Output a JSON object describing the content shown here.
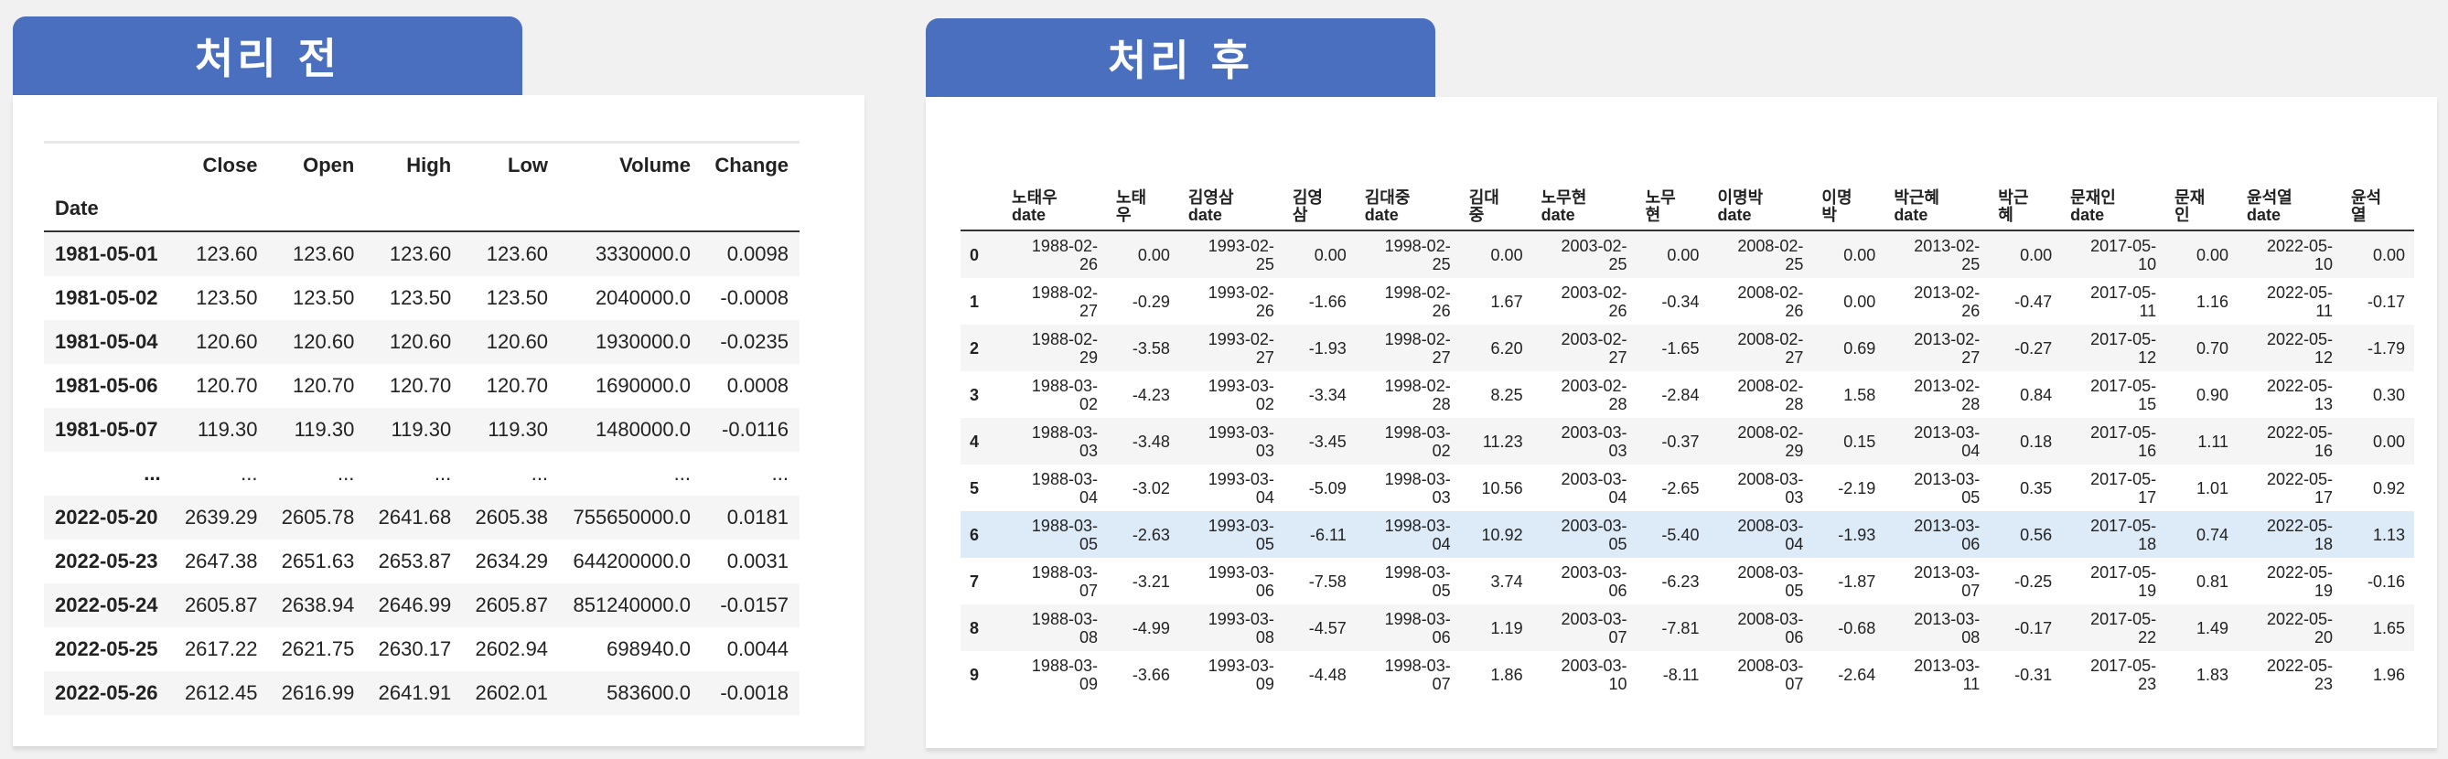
{
  "left_panel": {
    "title": "처리 전",
    "columns": [
      "Close",
      "Open",
      "High",
      "Low",
      "Volume",
      "Change"
    ],
    "index_name": "Date",
    "rows": [
      {
        "date": "1981-05-01",
        "values": [
          "123.60",
          "123.60",
          "123.60",
          "123.60",
          "3330000.0",
          "0.0098"
        ]
      },
      {
        "date": "1981-05-02",
        "values": [
          "123.50",
          "123.50",
          "123.50",
          "123.50",
          "2040000.0",
          "-0.0008"
        ]
      },
      {
        "date": "1981-05-04",
        "values": [
          "120.60",
          "120.60",
          "120.60",
          "120.60",
          "1930000.0",
          "-0.0235"
        ]
      },
      {
        "date": "1981-05-06",
        "values": [
          "120.70",
          "120.70",
          "120.70",
          "120.70",
          "1690000.0",
          "0.0008"
        ]
      },
      {
        "date": "1981-05-07",
        "values": [
          "119.30",
          "119.30",
          "119.30",
          "119.30",
          "1480000.0",
          "-0.0116"
        ]
      },
      {
        "date": "...",
        "values": [
          "...",
          "...",
          "...",
          "...",
          "...",
          "..."
        ]
      },
      {
        "date": "2022-05-20",
        "values": [
          "2639.29",
          "2605.78",
          "2641.68",
          "2605.38",
          "755650000.0",
          "0.0181"
        ]
      },
      {
        "date": "2022-05-23",
        "values": [
          "2647.38",
          "2651.63",
          "2653.87",
          "2634.29",
          "644200000.0",
          "0.0031"
        ]
      },
      {
        "date": "2022-05-24",
        "values": [
          "2605.87",
          "2638.94",
          "2646.99",
          "2605.87",
          "851240000.0",
          "-0.0157"
        ]
      },
      {
        "date": "2022-05-25",
        "values": [
          "2617.22",
          "2621.75",
          "2630.17",
          "2602.94",
          "698940.0",
          "0.0044"
        ]
      },
      {
        "date": "2022-05-26",
        "values": [
          "2612.45",
          "2616.99",
          "2641.91",
          "2602.01",
          "583600.0",
          "-0.0018"
        ]
      }
    ]
  },
  "right_panel": {
    "title": "처리 후",
    "columns": [
      {
        "l1": "노태우",
        "l2": "date"
      },
      {
        "l1": "노태",
        "l2": "우"
      },
      {
        "l1": "김영삼",
        "l2": "date"
      },
      {
        "l1": "김영",
        "l2": "삼"
      },
      {
        "l1": "김대중",
        "l2": "date"
      },
      {
        "l1": "김대",
        "l2": "중"
      },
      {
        "l1": "노무현",
        "l2": "date"
      },
      {
        "l1": "노무",
        "l2": "현"
      },
      {
        "l1": "이명박",
        "l2": "date"
      },
      {
        "l1": "이명",
        "l2": "박"
      },
      {
        "l1": "박근혜",
        "l2": "date"
      },
      {
        "l1": "박근",
        "l2": "혜"
      },
      {
        "l1": "문재인",
        "l2": "date"
      },
      {
        "l1": "문재",
        "l2": "인"
      },
      {
        "l1": "윤석열",
        "l2": "date"
      },
      {
        "l1": "윤석",
        "l2": "열"
      }
    ],
    "highlighted_row": 6,
    "rows": [
      {
        "idx": "0",
        "cells": [
          "1988-02-26",
          "0.00",
          "1993-02-25",
          "0.00",
          "1998-02-25",
          "0.00",
          "2003-02-25",
          "0.00",
          "2008-02-25",
          "0.00",
          "2013-02-25",
          "0.00",
          "2017-05-10",
          "0.00",
          "2022-05-10",
          "0.00"
        ]
      },
      {
        "idx": "1",
        "cells": [
          "1988-02-27",
          "-0.29",
          "1993-02-26",
          "-1.66",
          "1998-02-26",
          "1.67",
          "2003-02-26",
          "-0.34",
          "2008-02-26",
          "0.00",
          "2013-02-26",
          "-0.47",
          "2017-05-11",
          "1.16",
          "2022-05-11",
          "-0.17"
        ]
      },
      {
        "idx": "2",
        "cells": [
          "1988-02-29",
          "-3.58",
          "1993-02-27",
          "-1.93",
          "1998-02-27",
          "6.20",
          "2003-02-27",
          "-1.65",
          "2008-02-27",
          "0.69",
          "2013-02-27",
          "-0.27",
          "2017-05-12",
          "0.70",
          "2022-05-12",
          "-1.79"
        ]
      },
      {
        "idx": "3",
        "cells": [
          "1988-03-02",
          "-4.23",
          "1993-03-02",
          "-3.34",
          "1998-02-28",
          "8.25",
          "2003-02-28",
          "-2.84",
          "2008-02-28",
          "1.58",
          "2013-02-28",
          "0.84",
          "2017-05-15",
          "0.90",
          "2022-05-13",
          "0.30"
        ]
      },
      {
        "idx": "4",
        "cells": [
          "1988-03-03",
          "-3.48",
          "1993-03-03",
          "-3.45",
          "1998-03-02",
          "11.23",
          "2003-03-03",
          "-0.37",
          "2008-02-29",
          "0.15",
          "2013-03-04",
          "0.18",
          "2017-05-16",
          "1.11",
          "2022-05-16",
          "0.00"
        ]
      },
      {
        "idx": "5",
        "cells": [
          "1988-03-04",
          "-3.02",
          "1993-03-04",
          "-5.09",
          "1998-03-03",
          "10.56",
          "2003-03-04",
          "-2.65",
          "2008-03-03",
          "-2.19",
          "2013-03-05",
          "0.35",
          "2017-05-17",
          "1.01",
          "2022-05-17",
          "0.92"
        ]
      },
      {
        "idx": "6",
        "cells": [
          "1988-03-05",
          "-2.63",
          "1993-03-05",
          "-6.11",
          "1998-03-04",
          "10.92",
          "2003-03-05",
          "-5.40",
          "2008-03-04",
          "-1.93",
          "2013-03-06",
          "0.56",
          "2017-05-18",
          "0.74",
          "2022-05-18",
          "1.13"
        ]
      },
      {
        "idx": "7",
        "cells": [
          "1988-03-07",
          "-3.21",
          "1993-03-06",
          "-7.58",
          "1998-03-05",
          "3.74",
          "2003-03-06",
          "-6.23",
          "2008-03-05",
          "-1.87",
          "2013-03-07",
          "-0.25",
          "2017-05-19",
          "0.81",
          "2022-05-19",
          "-0.16"
        ]
      },
      {
        "idx": "8",
        "cells": [
          "1988-03-08",
          "-4.99",
          "1993-03-08",
          "-4.57",
          "1998-03-06",
          "1.19",
          "2003-03-07",
          "-7.81",
          "2008-03-06",
          "-0.68",
          "2013-03-08",
          "-0.17",
          "2017-05-22",
          "1.49",
          "2022-05-20",
          "1.65"
        ]
      },
      {
        "idx": "9",
        "cells": [
          "1988-03-09",
          "-3.66",
          "1993-03-09",
          "-4.48",
          "1998-03-07",
          "1.86",
          "2003-03-10",
          "-8.11",
          "2008-03-07",
          "-2.64",
          "2013-03-11",
          "-0.31",
          "2017-05-23",
          "1.83",
          "2022-05-23",
          "1.96"
        ]
      }
    ]
  },
  "colors": {
    "tab_background": "#4a6fbe",
    "highlight_row": "#ddeaf8",
    "stripe": "#f5f5f5",
    "page_background": "#f1f1f2"
  }
}
